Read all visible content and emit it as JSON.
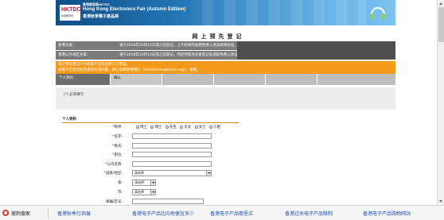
{
  "banner": {
    "logo_text": "HKTDC",
    "logo_sub": "香港貿發局",
    "small_text": "香港貿發局HKTDC",
    "title": "Hong Kong Electronics Fair (Autumn Edition)",
    "subtitle": "香港秋季電子產品展"
  },
  "page_title": "网上预先登记",
  "notices": {
    "gray_1_col1": "香港买家：",
    "gray_1_col2": "请于2016年10月11日或之前登记，上午机构的会把免费入场证邮寄给您。",
    "gray_2_col1": "香港以外地区买家：",
    "gray_2_col2": "请于2016年10月10日或之前登记，然后到现场买家登记处领取免费入场证。",
    "orange_line1": "网上预先登记只为有关行业的业界人士而设。",
    "orange_line2": "若阁下在登记程序遇到任何问题，请以电邮联络我们（exhibitions@hktdc.org）。谢谢。"
  },
  "steps": [
    {
      "num": "步骤 1",
      "label": "个人资料"
    },
    {
      "num": "步骤 2",
      "label": "确认"
    }
  ],
  "required_note": "(*) 必须填写",
  "section_title": "个人资料",
  "form": {
    "salutation_label": "称呼：",
    "salutations": [
      "博士",
      "博士",
      "先生",
      "太太",
      "女士",
      "小姐"
    ],
    "name_label": "名字：",
    "surname_label": "姓氏：",
    "position_label": "职位：",
    "company_label": "公司名称：",
    "country_label": "国家/地区：",
    "province_label": "省：",
    "city_label": "市：",
    "postcode_label": "邮编/区号：",
    "select_placeholder": "请选择"
  },
  "bottombar": {
    "brand": "搜狗搜索",
    "links": [
      "香港秋季灯饰展",
      "香港电子产品比内地便宜多少",
      "香港电子产品哪里买",
      "香港过关电子产品限制",
      "香港电子产品购物网站"
    ]
  },
  "colors": {
    "orange": "#f39a1b",
    "banner_blue": "#2a7fbf",
    "gray_bar": "#7b7b7b",
    "link_blue": "#1f4fb0"
  }
}
